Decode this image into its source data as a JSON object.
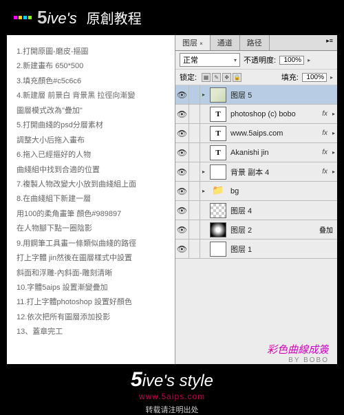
{
  "header": {
    "brand_num": "5",
    "brand_txt": "ive's",
    "title": "原創教程"
  },
  "steps": [
    "1.打開原圖-磨皮-摳圖",
    "2.新建畫布 650*500",
    "3.填充顏色#c5c6c6",
    "4.新建層 前景白 背景黑 拉徑向漸變",
    "  圖層模式改為\"疊加\"",
    "5.打開曲綫的psd分層素材",
    "  調整大小后拖入畫布",
    "6.拖入已經摳好的人物",
    "  曲綫組中找到合適的位置",
    "7.複製人物改變大小放到曲綫組上面",
    "8.在曲綫組下新建一層",
    "用100的柔角畫筆 顏色#989897",
    "在人物腳下點一圈陰影",
    "9.用鋼筆工具畫一條類似曲綫的路徑",
    "打上字體 jin然後在圖層樣式中設置",
    "斜面和浮雕-內斜面-雕刻清晰",
    "10.字體5aips 設置漸變疊加",
    "11.打上字體photoshop 設置好顏色",
    "12.依次把所有圖層添加投影",
    "13、蓋章完工"
  ],
  "panel": {
    "tabs": {
      "layers": "图层",
      "channels": "通道",
      "paths": "路径"
    },
    "blend": {
      "mode": "正常",
      "opacity_lbl": "不透明度:",
      "opacity": "100%"
    },
    "lock": {
      "lbl": "锁定:",
      "fill_lbl": "填充:",
      "fill": "100%"
    },
    "eye": "👁",
    "items": [
      {
        "type": "img",
        "name": "图层 5",
        "sel": true,
        "fx": false,
        "fold": true
      },
      {
        "type": "T",
        "name": "photoshop (c) bobo",
        "fx": true
      },
      {
        "type": "T",
        "name": "www.5aips.com",
        "fx": true
      },
      {
        "type": "T",
        "name": "Akanishi jin",
        "fx": true
      },
      {
        "type": "plain",
        "name": "背景 副本 4",
        "fx": true,
        "fold": true
      },
      {
        "type": "grp",
        "name": "bg",
        "fold": true
      },
      {
        "type": "checker",
        "name": "图层 4"
      },
      {
        "type": "grad",
        "name": "图层 2",
        "extra": "叠加"
      },
      {
        "type": "plain",
        "name": "图层 1"
      }
    ]
  },
  "credit": {
    "line1": "彩色曲線成簽",
    "line2": "BY BOBO"
  },
  "footer": {
    "num": "5",
    "txt": "ive's style",
    "url": "www.5aips.com",
    "note": "转载请注明出处"
  }
}
